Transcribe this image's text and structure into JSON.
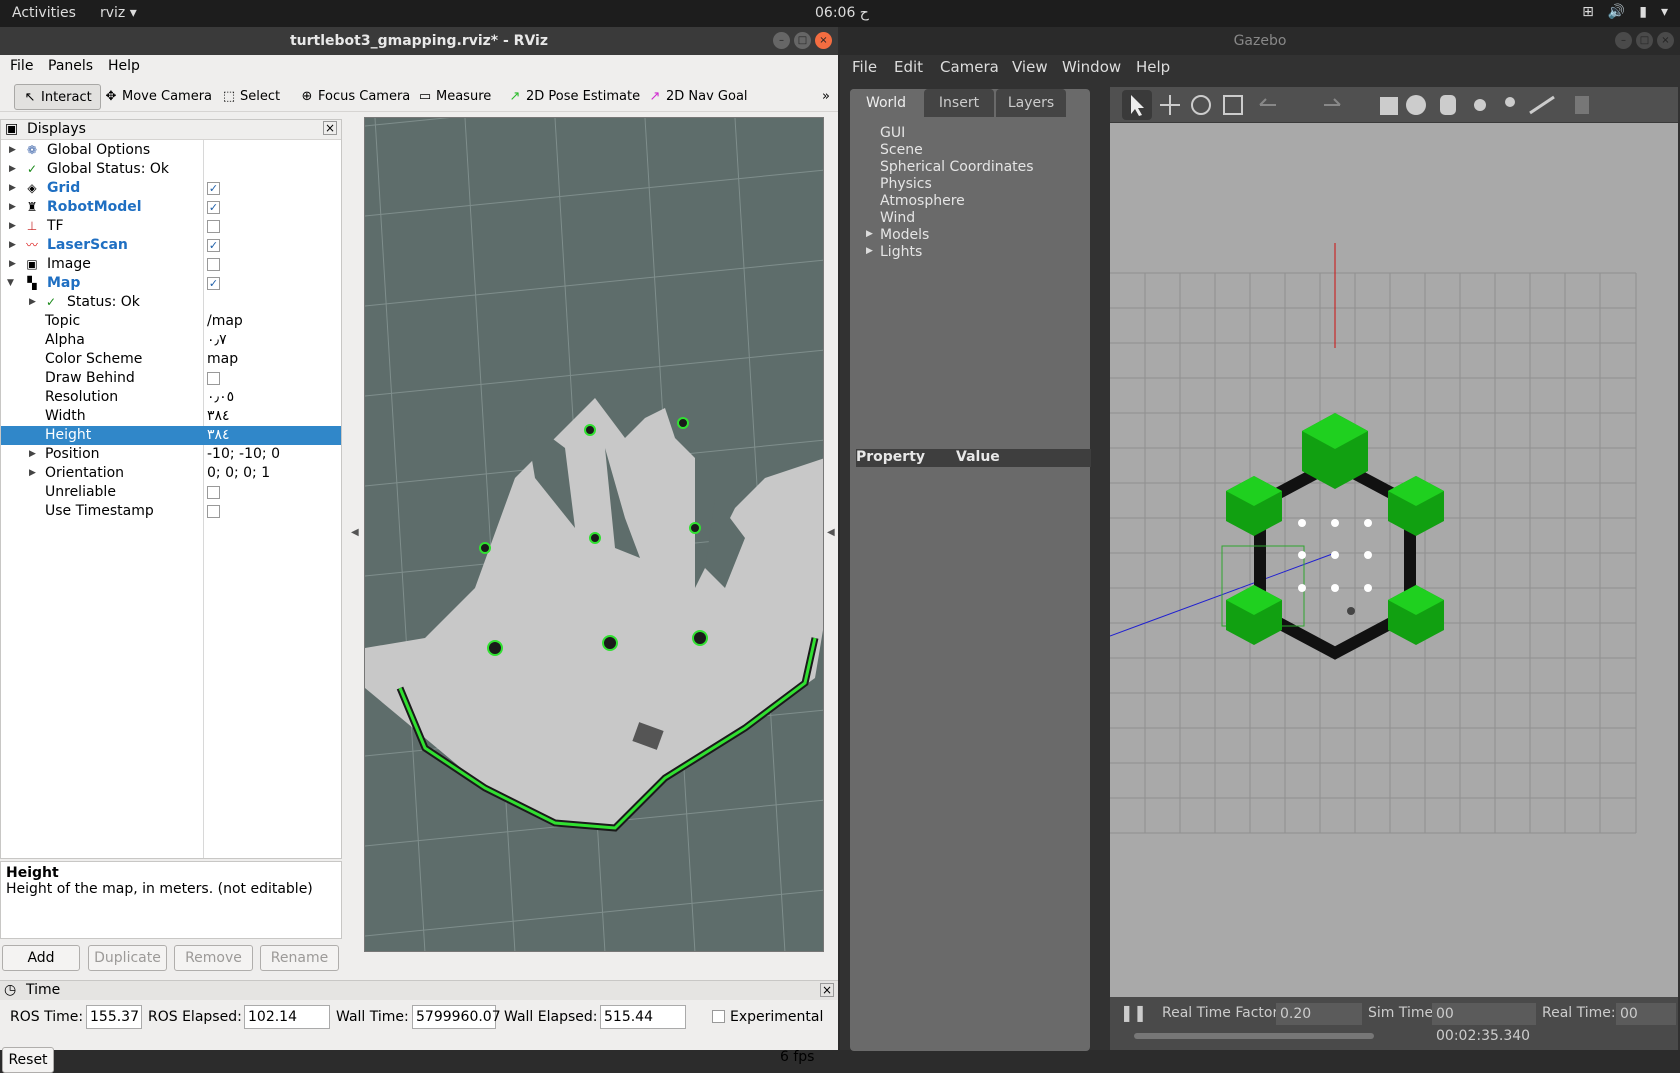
{
  "topbar": {
    "activities": "Activities",
    "app": "rviz ▾",
    "clock": "06:06 ح"
  },
  "rviz": {
    "title": "turtlebot3_gmapping.rviz* - RViz",
    "menu": [
      "File",
      "Panels",
      "Help"
    ],
    "tools": [
      "Interact",
      "Move Camera",
      "Select",
      "Focus Camera",
      "Measure",
      "2D Pose Estimate",
      "2D Nav Goal"
    ],
    "displays_title": "Displays",
    "tree": [
      {
        "label": "Global Options",
        "value": ""
      },
      {
        "label": "Global Status: Ok",
        "value": ""
      },
      {
        "label": "Grid",
        "value": ""
      },
      {
        "label": "RobotModel",
        "value": ""
      },
      {
        "label": "TF",
        "value": ""
      },
      {
        "label": "LaserScan",
        "value": ""
      },
      {
        "label": "Image",
        "value": ""
      },
      {
        "label": "Map",
        "value": ""
      },
      {
        "label": "Status: Ok",
        "value": ""
      },
      {
        "label": "Topic",
        "value": "/map"
      },
      {
        "label": "Alpha",
        "value": "٠٫٧"
      },
      {
        "label": "Color Scheme",
        "value": "map"
      },
      {
        "label": "Draw Behind",
        "value": ""
      },
      {
        "label": "Resolution",
        "value": "٠٫٠٥"
      },
      {
        "label": "Width",
        "value": "٣٨٤"
      },
      {
        "label": "Height",
        "value": "٣٨٤"
      },
      {
        "label": "Position",
        "value": "-10; -10; 0"
      },
      {
        "label": "Orientation",
        "value": "0; 0; 0; 1"
      },
      {
        "label": "Unreliable",
        "value": ""
      },
      {
        "label": "Use Timestamp",
        "value": ""
      }
    ],
    "help_title": "Height",
    "help_text": "Height of the map, in meters. (not editable)",
    "buttons": [
      "Add",
      "Duplicate",
      "Remove",
      "Rename"
    ],
    "time_title": "Time",
    "ros_time_label": "ROS Time:",
    "ros_time": "155.37",
    "ros_elapsed_label": "ROS Elapsed:",
    "ros_elapsed": "102.14",
    "wall_time_label": "Wall Time:",
    "wall_time": "5799960.07",
    "wall_elapsed_label": "Wall Elapsed:",
    "wall_elapsed": "515.44",
    "experimental": "Experimental",
    "reset": "Reset",
    "fps": "6 fps"
  },
  "gazebo": {
    "title": "Gazebo",
    "menu": [
      "File",
      "Edit",
      "Camera",
      "View",
      "Window",
      "Help"
    ],
    "tabs": [
      "World",
      "Insert",
      "Layers"
    ],
    "tree": [
      "GUI",
      "Scene",
      "Spherical Coordinates",
      "Physics",
      "Atmosphere",
      "Wind",
      "Models",
      "Lights"
    ],
    "prop_label": "Property",
    "value_label": "Value",
    "rtf_label": "Real Time Factor:",
    "rtf": "0.20",
    "sim_label": "Sim Time:",
    "sim": "00 00:02:35.340",
    "real_label": "Real Time:",
    "real": "00"
  }
}
